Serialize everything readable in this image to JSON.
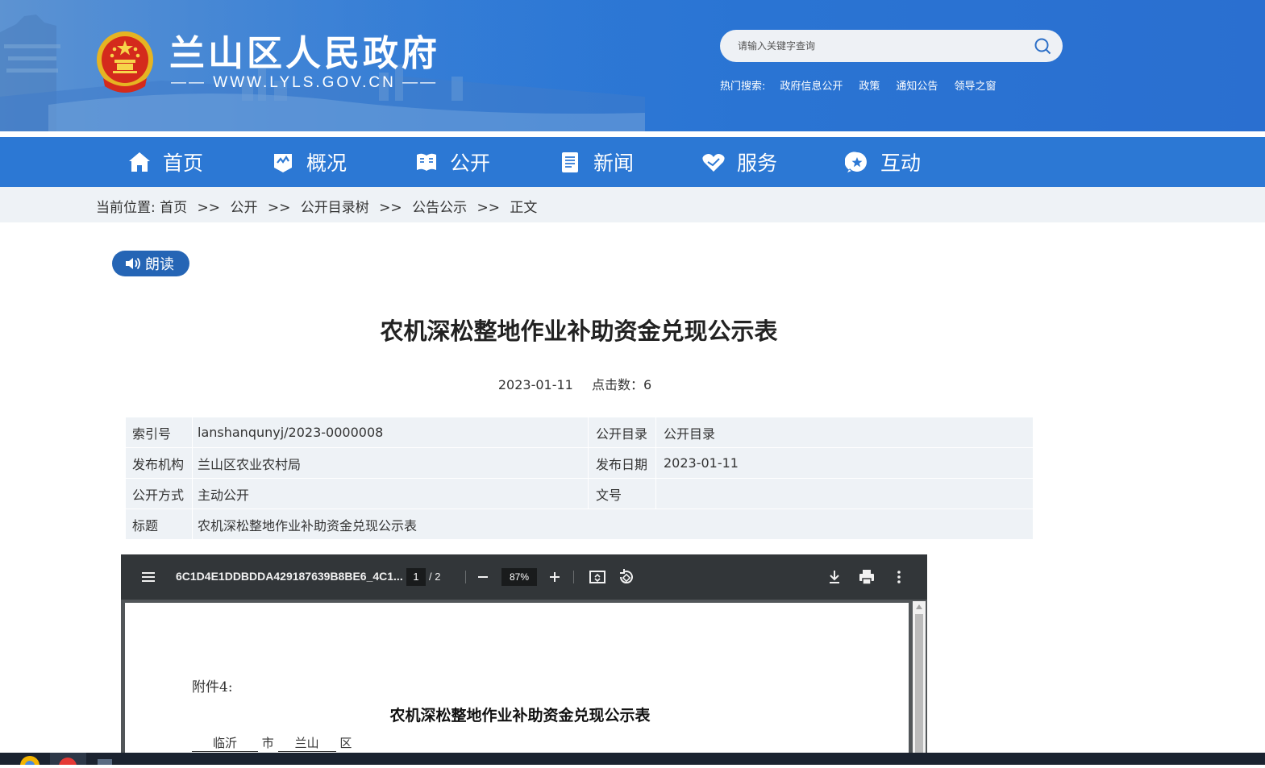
{
  "header": {
    "site_name": "兰山区人民政府",
    "site_url": "—— WWW.LYLS.GOV.CN ——",
    "search_placeholder": "请输入关键字查询",
    "hot_label": "热门搜索:",
    "hot_links": [
      "政府信息公开",
      "政策",
      "通知公告",
      "领导之窗"
    ]
  },
  "nav": {
    "items": [
      {
        "label": "首页",
        "icon": "home-icon"
      },
      {
        "label": "概况",
        "icon": "overview-icon"
      },
      {
        "label": "公开",
        "icon": "book-icon"
      },
      {
        "label": "新闻",
        "icon": "news-icon"
      },
      {
        "label": "服务",
        "icon": "service-icon"
      },
      {
        "label": "互动",
        "icon": "interact-icon"
      }
    ]
  },
  "breadcrumb": {
    "prefix": "当前位置:",
    "items": [
      "首页",
      "公开",
      "公开目录树",
      "公告公示",
      "正文"
    ],
    "separator": ">>"
  },
  "read_button": "朗读",
  "article": {
    "title": "农机深松整地作业补助资金兑现公示表",
    "date": "2023-01-11",
    "clicks": "点击数：6"
  },
  "info_table": {
    "rows": [
      {
        "k1": "索引号",
        "v1": "lanshanqunyj/2023-0000008",
        "k2": "公开目录",
        "v2": "公开目录"
      },
      {
        "k1": "发布机构",
        "v1": "兰山区农业农村局",
        "k2": "发布日期",
        "v2": "2023-01-11"
      },
      {
        "k1": "公开方式",
        "v1": "主动公开",
        "k2": "文号",
        "v2": ""
      },
      {
        "k1": "标题",
        "v1": "农机深松整地作业补助资金兑现公示表"
      }
    ]
  },
  "pdf": {
    "filename": "6C1D4E1DDBDDA429187639B8BE6_4C1...",
    "page": "1",
    "page_of": "/  2",
    "zoom": "87%",
    "doc_attachment": "附件4:",
    "doc_title": "农机深松整地作业补助资金兑现公示表",
    "doc_city": "临沂",
    "doc_city_unit": "市",
    "doc_district": "兰山",
    "doc_district_unit": "区"
  },
  "colors": {
    "header_blue": "#2f7ad6",
    "nav_blue": "#2c78d4",
    "read_button": "#2565b5",
    "pdf_toolbar": "#323639"
  }
}
